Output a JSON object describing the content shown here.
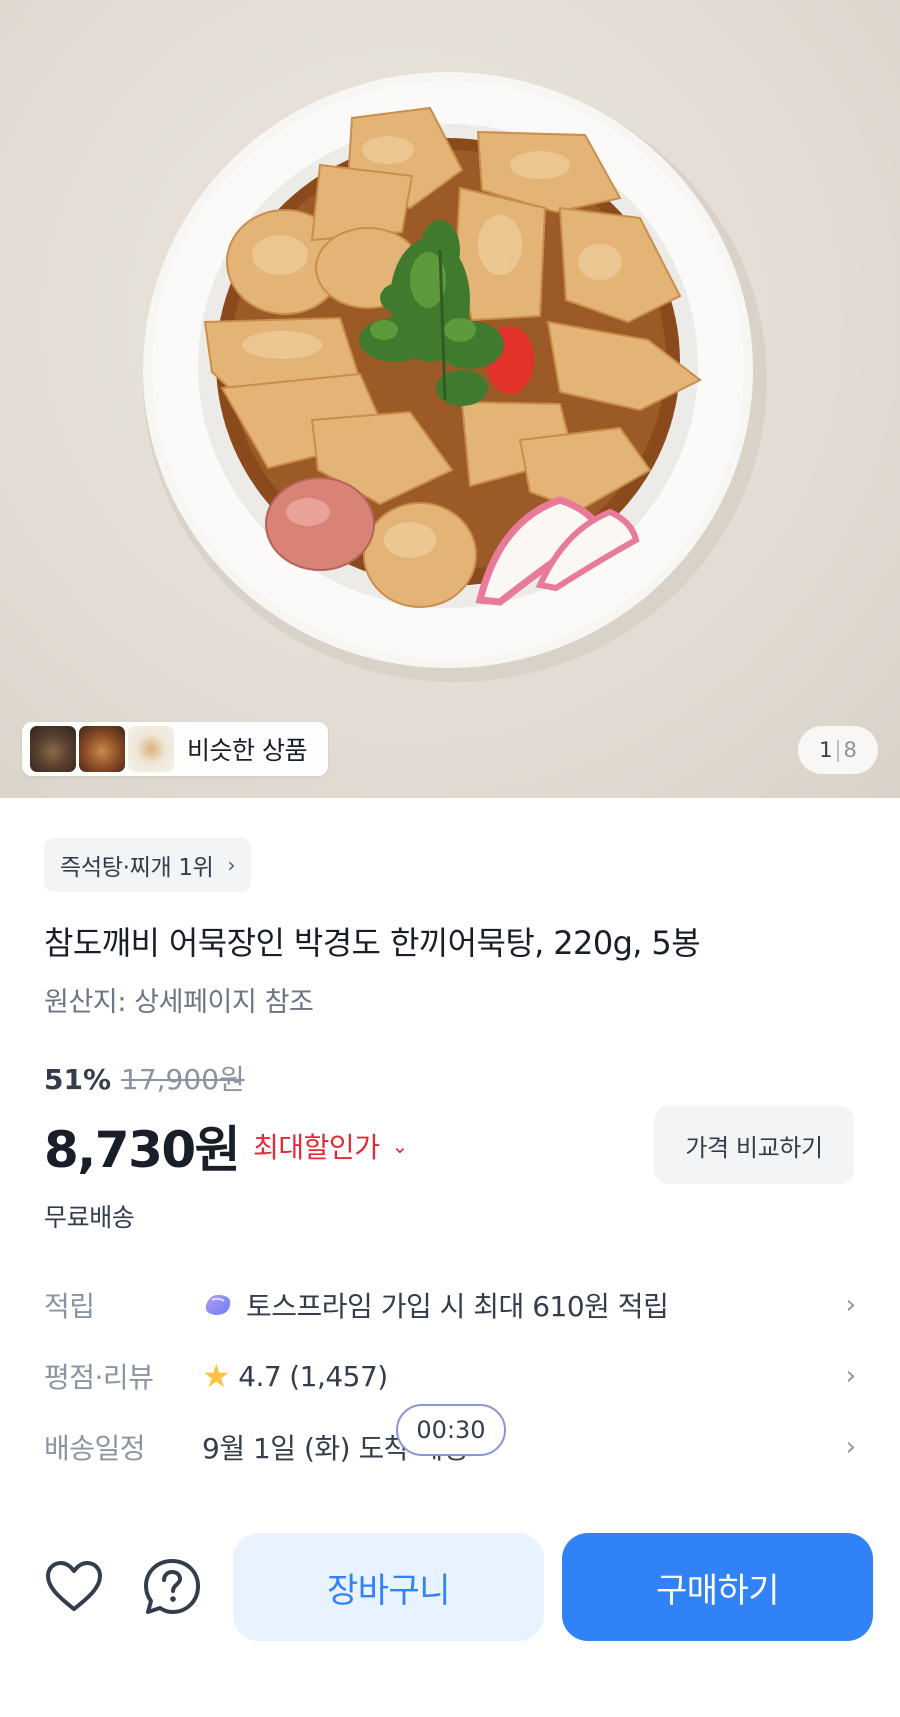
{
  "hero": {
    "image_alt": "어묵탕",
    "similar_label": "비슷한 상품",
    "counter_current": "1",
    "counter_total": "8"
  },
  "product": {
    "rank_badge": "즉석탕·찌개 1위",
    "title": "참도깨비 어묵장인 박경도 한끼어묵탕, 220g, 5봉",
    "origin": "원산지: 상세페이지 참조",
    "discount_percent": "51%",
    "original_price": "17,900원",
    "price": "8,730원",
    "max_discount_label": "최대할인가",
    "compare_button": "가격 비교하기",
    "shipping": "무료배송"
  },
  "info_rows": [
    {
      "label": "적립",
      "value": "토스프라임 가입 시 최대 610원 적립",
      "icon": "gem-icon"
    },
    {
      "label": "평점·리뷰",
      "rating": "4.7",
      "review_count": "(1,457)",
      "icon": "star-icon"
    },
    {
      "label": "배송일정",
      "value": "9월 1일 (화) 도착 예정"
    }
  ],
  "timer": "00:30",
  "actions": {
    "cart": "장바구니",
    "buy": "구매하기"
  },
  "colors": {
    "accent": "#3182f6",
    "accent_light": "#e8f3ff",
    "discount_red": "#e42939",
    "star": "#ffc342"
  }
}
